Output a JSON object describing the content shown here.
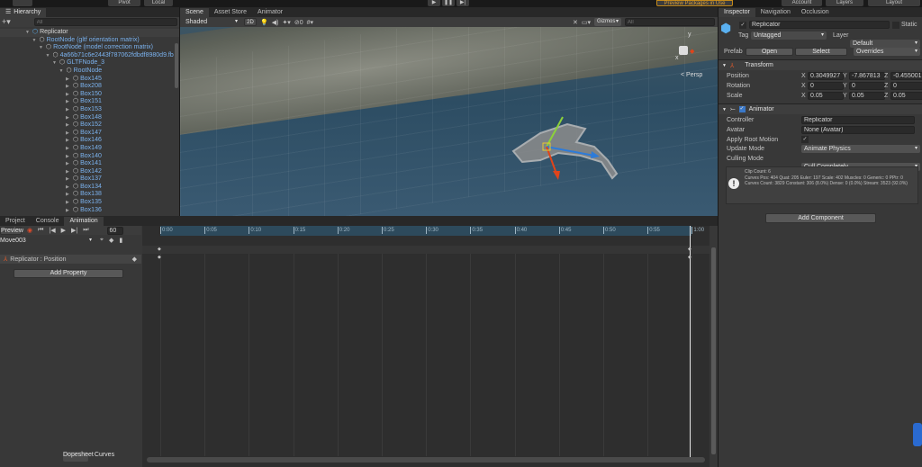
{
  "toolbar": {
    "pivot": "Pivot",
    "local": "Local",
    "play": "▶",
    "pause": "❚❚",
    "step": "▶|",
    "preview_packages": "Preview Packages in Use",
    "account": "Account",
    "layers": "Layers",
    "layout": "Layout"
  },
  "hierarchy": {
    "tab": "Hierarchy",
    "search_placeholder": "All",
    "items": [
      {
        "label": "Replicator",
        "depth": 0
      },
      {
        "label": "RootNode (gltf orientation matrix)",
        "depth": 1
      },
      {
        "label": "RootNode (model correction matrix)",
        "depth": 2
      },
      {
        "label": "4a66b71c6e2443f787062fdbdf8980d9.fb",
        "depth": 3
      },
      {
        "label": "GLTFNode_3",
        "depth": 4
      },
      {
        "label": "RootNode",
        "depth": 5
      },
      {
        "label": "Box145",
        "depth": 6
      },
      {
        "label": "Box208",
        "depth": 6
      },
      {
        "label": "Box150",
        "depth": 6
      },
      {
        "label": "Box151",
        "depth": 6
      },
      {
        "label": "Box153",
        "depth": 6
      },
      {
        "label": "Box148",
        "depth": 6
      },
      {
        "label": "Box152",
        "depth": 6
      },
      {
        "label": "Box147",
        "depth": 6
      },
      {
        "label": "Box146",
        "depth": 6
      },
      {
        "label": "Box149",
        "depth": 6
      },
      {
        "label": "Box140",
        "depth": 6
      },
      {
        "label": "Box141",
        "depth": 6
      },
      {
        "label": "Box142",
        "depth": 6
      },
      {
        "label": "Box137",
        "depth": 6
      },
      {
        "label": "Box134",
        "depth": 6
      },
      {
        "label": "Box138",
        "depth": 6
      },
      {
        "label": "Box135",
        "depth": 6
      },
      {
        "label": "Box136",
        "depth": 6
      }
    ]
  },
  "scene": {
    "tabs": [
      "Scene",
      "Asset Store",
      "Animator"
    ],
    "shading": "Shaded",
    "mode2d": "2D",
    "hidden_count": "0",
    "gizmos": "Gizmos",
    "search_placeholder": "All",
    "persp": "< Persp",
    "axis_y": "y",
    "axis_x": "x"
  },
  "inspector": {
    "tabs": [
      "Inspector",
      "Navigation",
      "Occlusion"
    ],
    "object_name": "Replicator",
    "static": "Static",
    "tag_label": "Tag",
    "tag": "Untagged",
    "layer_label": "Layer",
    "layer": "Default",
    "prefab_label": "Prefab",
    "open": "Open",
    "select": "Select",
    "overrides": "Overrides",
    "transform": {
      "title": "Transform",
      "position_label": "Position",
      "rotation_label": "Rotation",
      "scale_label": "Scale",
      "position": [
        "0.3049927",
        "-7.867813",
        "-0.455001"
      ],
      "rotation": [
        "0",
        "0",
        "0"
      ],
      "scale": [
        "0.05",
        "0.05",
        "0.05"
      ]
    },
    "animator": {
      "title": "Animator",
      "controller_label": "Controller",
      "controller": "Replicator",
      "avatar_label": "Avatar",
      "avatar": "None (Avatar)",
      "root_motion_label": "Apply Root Motion",
      "update_label": "Update Mode",
      "update": "Animate Physics",
      "culling_label": "Culling Mode",
      "culling": "Cull Completely",
      "info": [
        "Clip Count: 6",
        "Curves Pos: 404 Quat: 205 Euler: 197 Scale: 402 Muscles: 0 Generic: 0 PPtr: 0",
        "Curves Count: 3829 Constant: 306 (8.0%) Dense: 0 (0.0%) Stream: 3523 (92.0%)"
      ]
    },
    "add_component": "Add Component"
  },
  "animation": {
    "tabs": [
      "Project",
      "Console",
      "Animation"
    ],
    "preview": "Preview",
    "frame": "60",
    "clip": "Move003",
    "property": "Replicator : Position",
    "add_property": "Add Property",
    "ticks": [
      "0:00",
      "0:05",
      "0:10",
      "0:15",
      "0:20",
      "0:25",
      "0:30",
      "0:35",
      "0:40",
      "0:45",
      "0:50",
      "0:55",
      "1:00"
    ],
    "dopesheet": "Dopesheet",
    "curves": "Curves"
  }
}
